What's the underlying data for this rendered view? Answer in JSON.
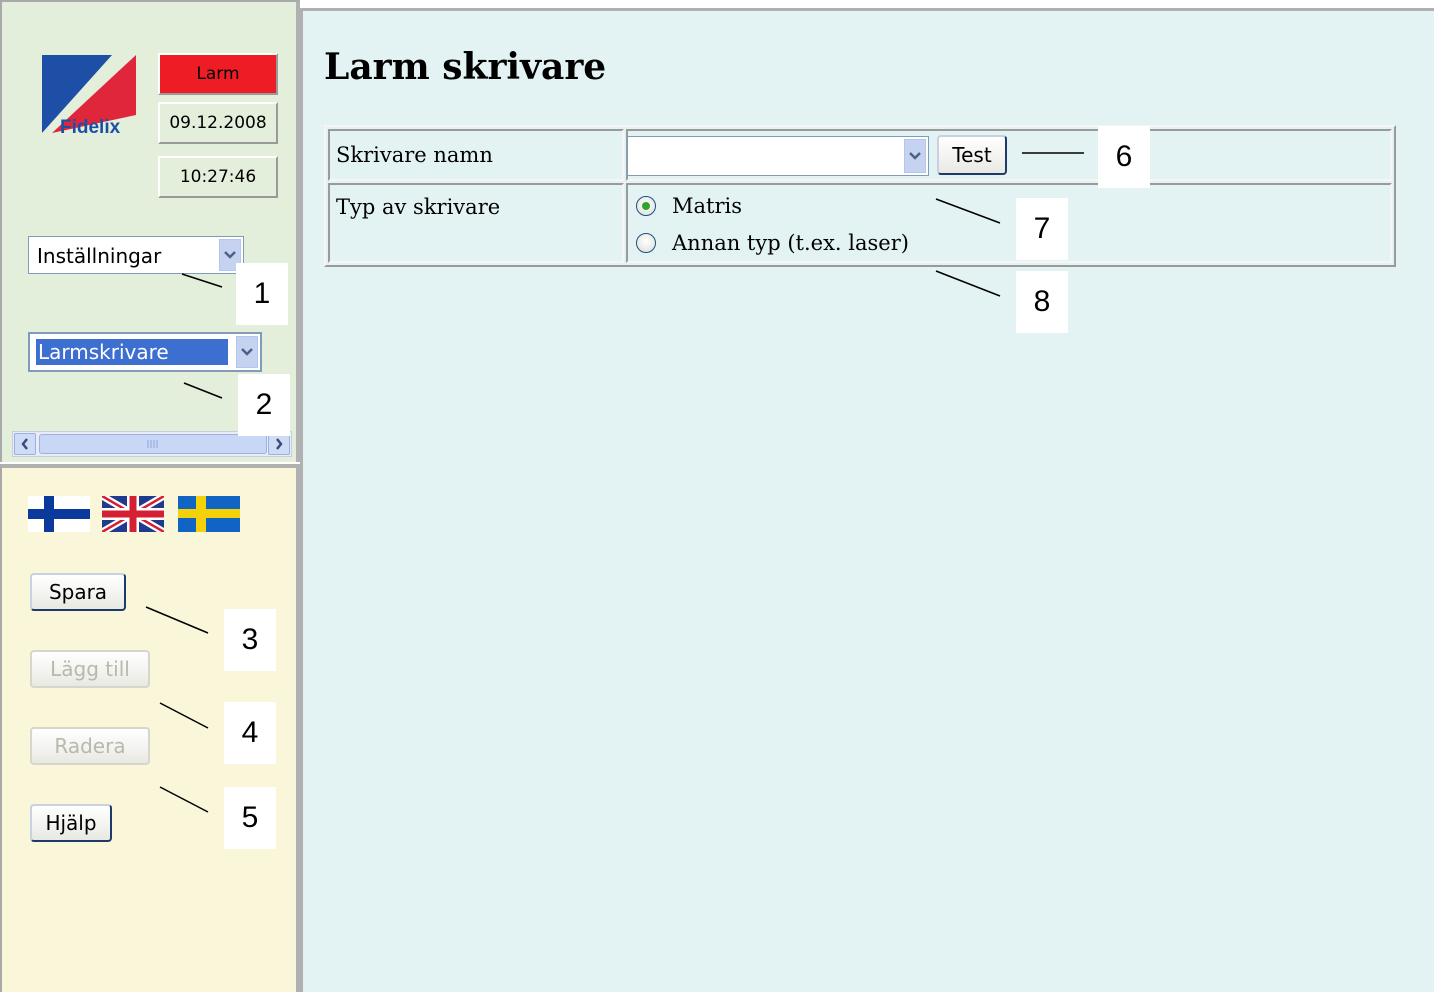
{
  "status": {
    "alarm_label": "Larm",
    "date": "09.12.2008",
    "time": "10:27:46"
  },
  "logo": {
    "text": "Fidelix"
  },
  "menus": {
    "category_selected": "Inställningar",
    "page_selected": "Larmskrivare"
  },
  "languages": [
    {
      "icon": "flag-finland-icon"
    },
    {
      "icon": "flag-uk-icon"
    },
    {
      "icon": "flag-sweden-icon"
    }
  ],
  "buttons": {
    "save": "Spara",
    "add": "Lägg till",
    "delete": "Radera",
    "help": "Hjälp",
    "test": "Test"
  },
  "page": {
    "title": "Larm skrivare",
    "printer_name_label": "Skrivare namn",
    "printer_name_value": "",
    "printer_type_label": "Typ av skrivare",
    "printer_type_options": [
      {
        "label": "Matris",
        "checked": true
      },
      {
        "label": "Annan typ (t.ex. laser)",
        "checked": false
      }
    ]
  },
  "callouts": [
    "1",
    "2",
    "3",
    "4",
    "5",
    "6",
    "7",
    "8"
  ],
  "colors": {
    "alarm": "#ee1c25",
    "top_frame": "#e3eedb",
    "bottom_frame": "#faf6da",
    "main_bg": "#e3f2f2",
    "selection": "#3d6fd0"
  }
}
